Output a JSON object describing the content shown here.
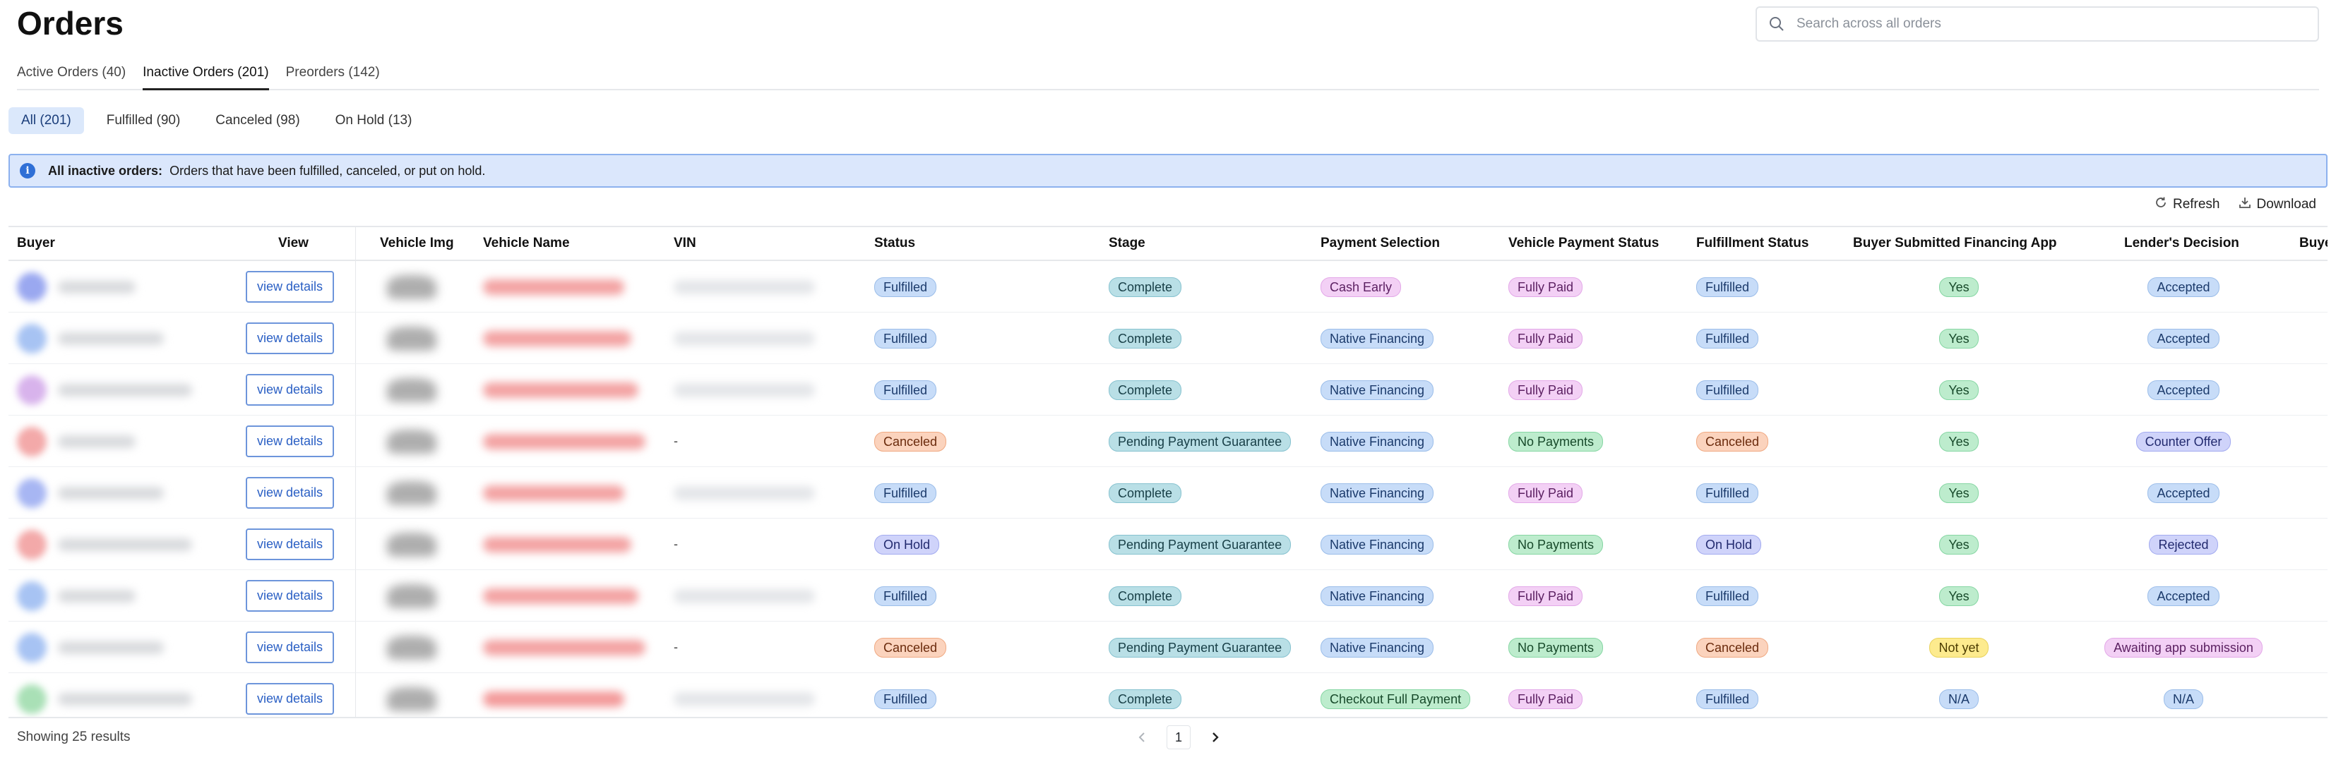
{
  "page_title": "Orders",
  "search": {
    "placeholder": "Search across all orders"
  },
  "tabs": [
    {
      "label": "Active Orders (40)",
      "active": false
    },
    {
      "label": "Inactive Orders (201)",
      "active": true
    },
    {
      "label": "Preorders (142)",
      "active": false
    }
  ],
  "filters": [
    {
      "label": "All (201)",
      "active": true
    },
    {
      "label": "Fulfilled (90)",
      "active": false
    },
    {
      "label": "Canceled (98)",
      "active": false
    },
    {
      "label": "On Hold (13)",
      "active": false
    }
  ],
  "banner": {
    "bold": "All inactive orders:",
    "text": "Orders that have been fulfilled, canceled, or put on hold."
  },
  "actions": {
    "refresh": "Refresh",
    "download": "Download"
  },
  "table": {
    "columns": [
      "Buyer",
      "View",
      "Vehicle Img",
      "Vehicle Name",
      "VIN",
      "Status",
      "Stage",
      "Payment Selection",
      "Vehicle Payment Status",
      "Fulfillment Status",
      "Buyer Submitted Financing App",
      "Lender's Decision",
      "Buye"
    ],
    "view_label": "view details",
    "rows": [
      {
        "avatar_color": "#9aa8f0",
        "name_color": "#d8dadd",
        "car_color": "#f3a3a3",
        "vin": "blur",
        "status": "Fulfilled",
        "stage": "Complete",
        "payment": "Cash Early",
        "vps": "Fully Paid",
        "fulfillment": "Fulfilled",
        "fin_app": "Yes",
        "lender": "Accepted"
      },
      {
        "avatar_color": "#a7c3f3",
        "name_color": "#d8dadd",
        "car_color": "#f3a3a3",
        "vin": "blur",
        "status": "Fulfilled",
        "stage": "Complete",
        "payment": "Native Financing",
        "vps": "Fully Paid",
        "fulfillment": "Fulfilled",
        "fin_app": "Yes",
        "lender": "Accepted"
      },
      {
        "avatar_color": "#d8b3ec",
        "name_color": "#d8dadd",
        "car_color": "#f3a3a3",
        "vin": "blur",
        "status": "Fulfilled",
        "stage": "Complete",
        "payment": "Native Financing",
        "vps": "Fully Paid",
        "fulfillment": "Fulfilled",
        "fin_app": "Yes",
        "lender": "Accepted"
      },
      {
        "avatar_color": "#f3a9a9",
        "name_color": "#d8dadd",
        "car_color": "#f3a3a3",
        "vin": "-",
        "status": "Canceled",
        "stage": "Pending Payment Guarantee",
        "payment": "Native Financing",
        "vps": "No Payments",
        "fulfillment": "Canceled",
        "fin_app": "Yes",
        "lender": "Counter Offer"
      },
      {
        "avatar_color": "#a7b6f3",
        "name_color": "#d8dadd",
        "car_color": "#f3a3a3",
        "vin": "blur",
        "status": "Fulfilled",
        "stage": "Complete",
        "payment": "Native Financing",
        "vps": "Fully Paid",
        "fulfillment": "Fulfilled",
        "fin_app": "Yes",
        "lender": "Accepted"
      },
      {
        "avatar_color": "#f3a9a9",
        "name_color": "#d8dadd",
        "car_color": "#f3a3a3",
        "vin": "-",
        "status": "On Hold",
        "stage": "Pending Payment Guarantee",
        "payment": "Native Financing",
        "vps": "No Payments",
        "fulfillment": "On Hold",
        "fin_app": "Yes",
        "lender": "Rejected"
      },
      {
        "avatar_color": "#a7c3f3",
        "name_color": "#d8dadd",
        "car_color": "#f3a3a3",
        "vin": "blur",
        "status": "Fulfilled",
        "stage": "Complete",
        "payment": "Native Financing",
        "vps": "Fully Paid",
        "fulfillment": "Fulfilled",
        "fin_app": "Yes",
        "lender": "Accepted"
      },
      {
        "avatar_color": "#a7c3f3",
        "name_color": "#d8dadd",
        "car_color": "#f3a3a3",
        "vin": "-",
        "status": "Canceled",
        "stage": "Pending Payment Guarantee",
        "payment": "Native Financing",
        "vps": "No Payments",
        "fulfillment": "Canceled",
        "fin_app": "Not yet",
        "lender": "Awaiting app submission"
      },
      {
        "avatar_color": "#a9e0b6",
        "name_color": "#d8dadd",
        "car_color": "#f39a9a",
        "vin": "blur",
        "status": "Fulfilled",
        "stage": "Complete",
        "payment": "Checkout Full Payment",
        "vps": "Fully Paid",
        "fulfillment": "Fulfilled",
        "fin_app": "N/A",
        "lender": "N/A"
      }
    ]
  },
  "footer": {
    "count_text": "Showing 25 results",
    "current_page": "1"
  },
  "colors": {
    "accent": "#2a5fc4",
    "banner_bg": "#dbe7fc",
    "badge_fulfilled": "#c7dcf8",
    "badge_canceled": "#fbd3bd",
    "badge_paid": "#f3d0f5",
    "badge_no_payments": "#bdeccd"
  }
}
